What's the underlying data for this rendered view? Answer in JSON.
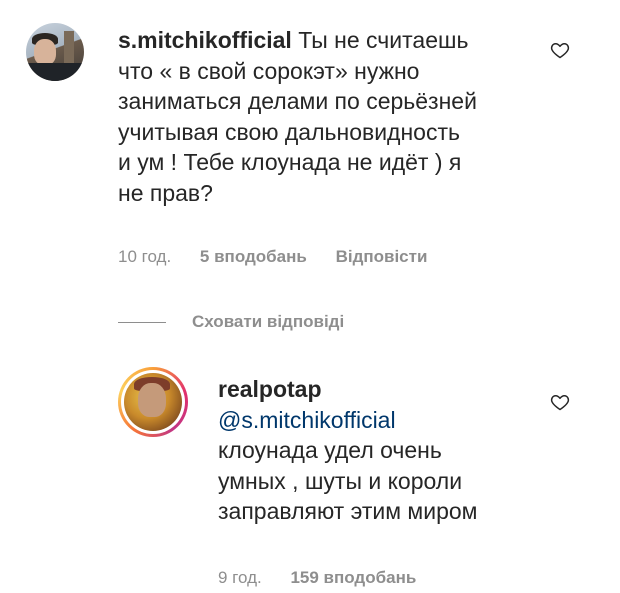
{
  "comments": [
    {
      "username": "s.mitchikofficial",
      "text_first": " Ты не считаешь",
      "lines": [
        "что « в свой сорокэт» нужно",
        "заниматься делами по серьёзней",
        "учитывая свою дальновидность",
        "и ум ! Тебе клоунада не идёт ) я",
        "не прав?"
      ],
      "time": "10 год.",
      "likes": "5 вподобань",
      "reply_label": "Відповісти",
      "avatar_icon": "profile-photo",
      "like_icon": "heart-outline-icon"
    }
  ],
  "thread": {
    "hide_replies_label": "Сховати відповіді"
  },
  "reply": {
    "username": "realpotap",
    "mention": "@s.mitchikofficial",
    "lines": [
      "клоунада удел очень",
      "умных , шуты и короли",
      "заправляют этим миром"
    ],
    "time": "9 год.",
    "likes": "159 вподобань",
    "avatar_icon": "profile-photo-story-ring",
    "like_icon": "heart-outline-icon"
  },
  "colors": {
    "text": "#262626",
    "meta": "#8e8e8e",
    "mention": "#00376b"
  }
}
